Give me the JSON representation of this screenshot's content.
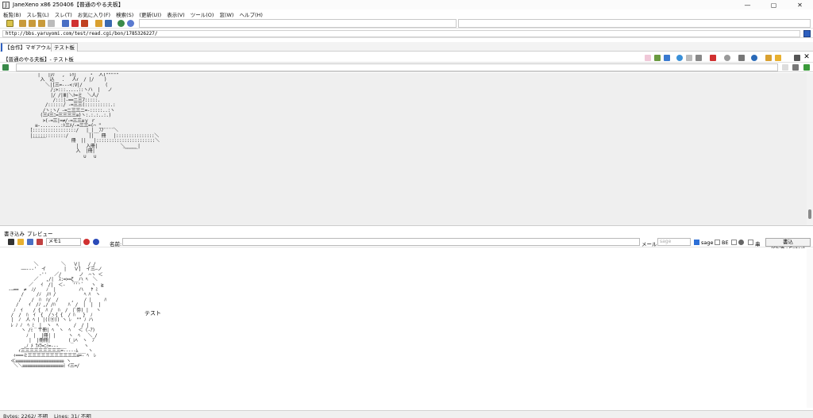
{
  "window": {
    "title": "JaneXeno x86 250406【普通のやる夫板】",
    "minimize": "—",
    "maximize": "▢",
    "close": "✕"
  },
  "menu": [
    "板覧(B)",
    "スレ覧(L)",
    "スレ(T)",
    "お気に入り(F)",
    "検索(S)",
    "(更新(U))",
    "表示(V)",
    "ツール(O)",
    "窓(W)",
    "ヘルプ(H)"
  ],
  "url": {
    "value": "http://bbs.yaruyomi.com/test/read.cgi/bon/1785326227/"
  },
  "board_tabs": [
    "【合作】マギアウルム...",
    "テスト板"
  ],
  "thread": {
    "title": "【普通のやる夫板】- テスト板"
  },
  "write": {
    "tab_write": "書き込み",
    "tab_preview": "プレビュー",
    "memo_select": "メモ1",
    "name_label": "名前:",
    "mail_label": "メール:",
    "mail_value": "sage",
    "sage_label": "sage",
    "be_label": "BE",
    "sub_label": "串",
    "submit_label": "書込(Shift+Enter)",
    "body_text": "テスト"
  },
  "status": {
    "bytes": "Bytes: 2262/ 不明",
    "lines": "Lines: 31/ 不明"
  },
  "colors": {
    "accent": "#2d5fbf",
    "thread_bg": "#efefef"
  },
  "thread_aa": "      |   |ﾚﾘ   ,  ﾚﾘ|     ・  人(\"\"\"\"\"\n       入  込   .   人ｨ  / |/    )\n         ＼|[三=---<:V|/         (\n           /;>:::.....::ヽハ  |   ノ\n           |/ /|Ⅲ|＼ﾄ=ミ  ＼人/\n            /:::|-==ニ三7:::::.\n         /::::::/ -=三三(::::::::::.:\n        /ヽ:ヽ/ -=ニ三三ニ=-:::::..:ヽ\n       (三ﾒ三ﾆ=三三三三≡)ヽ:.:.:..:.)\n        >(-=三|=≠/-=三三≡ｙ ｒ\n     ≡-........:ﾄ三ﾒ/-=三三=(⌒ \"\n   [:::::::::::::::::/   |_|__ﾌ7¨¨¨¨＼\n   |:::::::::::::/        ||   冊   |:::::::::::::::＼\n    ￣￣￣          冊  ||   |:::::::::::::::::::::::＼\n                     |   入冊|         ＼_____|\n                     入  |冊|           ￣￣￣\n                        ∪   ∪",
  "write_aa": "            ＼         ＼   Ｖ|   / /\n       ――--‐'  イ       |   Ｖ]  イ三―ノ\n              ‐''   ／/       ノ  ⌒ヽ ＜\n            ／   ,/|  ｽ:=>=ζ__ハ ﾍ  ＼\n          ／   ｲ  /|  ＜-   ''' ﾞ   ヽ  ≧\n  ‐―==  ≠  ﾉ/    ﾉ  |         ハ   ﾔ ﾐ\n       /     /ﾉ  /ﾊ /           ﾍ ﾊ  ヽ\n      /    /  ﾊ  ﾊ/  /     ,    / |     ﾊ\n     /    ｲ  /ﾉ ,/ /ﾊ     ﾊ  /  |  |  |\n    ﾉ  ｲ    / {  ﾊ /  ﾊ  /  (ﾞ劵) |   ヽ\n   /  /  ﾊ  ｲ  {  /ヽ{ {  / ﾊ   }  ﾉ\n   |  ﾉ  人 ﾍ | |((⑪)) ヽ ﾚ  \"\" ﾉ ハ\n   ﾚ ﾉ ﾉ  ﾍ ﾐ_ |  ヽ  ﾍ      /  / |\n       ヽ /ﾐ  〒冊| ﾍ  ヽ  ﾍ   ＜ (-ｱ)\n         ﾉ  |  |冊| |     ヽ  ﾍ   ＼_/\n          |  |冊冊|       (_ﾚﾍ  ヽ  ﾉ\n        ,ﾉ ﾒ ﾗﾒﾗ=ﾆﾐ=---___       ヽ\n      ｨ三三三三三三三三三=-----ﾑ___ ヽ\n    ｨ===ミ三三三三三三三三三三三≡=- ﾍ  ﾚ\n   ≪≡≡≡≡≡≡≡≡≡≡≡≡≡≡≡≡≡≡≡ ヽ\n    ＼＼≡≡≡≡≡≡≡≡≡≡≡≡≡≡≡≡ﾐ ｲ三=/"
}
